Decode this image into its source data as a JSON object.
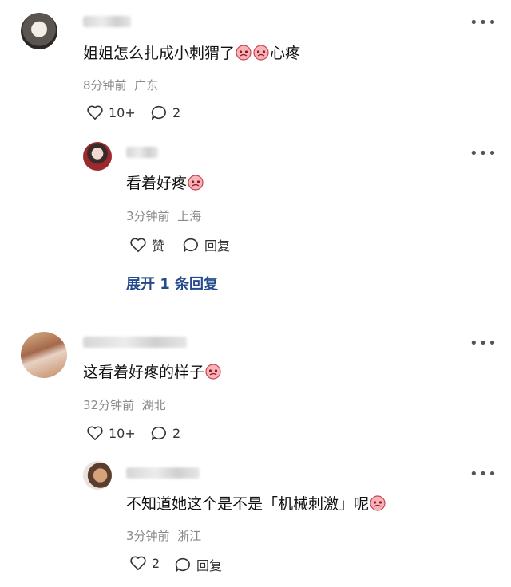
{
  "comments": [
    {
      "text": "姐姐怎么扎成小刺猬了",
      "text_suffix": "心疼",
      "time": "8分钟前",
      "location": "广东",
      "likes": "10+",
      "replies": "2",
      "reply": {
        "text": "看着好疼",
        "time": "3分钟前",
        "location": "上海",
        "like_label": "赞",
        "reply_label": "回复",
        "expand_label": "展开 1 条回复"
      }
    },
    {
      "text": "这看着好疼的样子",
      "time": "32分钟前",
      "location": "湖北",
      "likes": "10+",
      "replies": "2",
      "reply": {
        "text_open": "不知道她这个是不是「机械刺激」呢",
        "time": "3分钟前",
        "location": "浙江",
        "likes": "2",
        "reply_label": "回复"
      }
    }
  ],
  "icons": {
    "more": "more-dots-icon",
    "like": "heart-outline-icon",
    "comment": "speech-bubble-icon",
    "emoji": "crying-face-emoji"
  },
  "colors": {
    "link": "#234a8c",
    "meta": "#8a8a8a",
    "emoji_face": "#f3a3a8"
  }
}
